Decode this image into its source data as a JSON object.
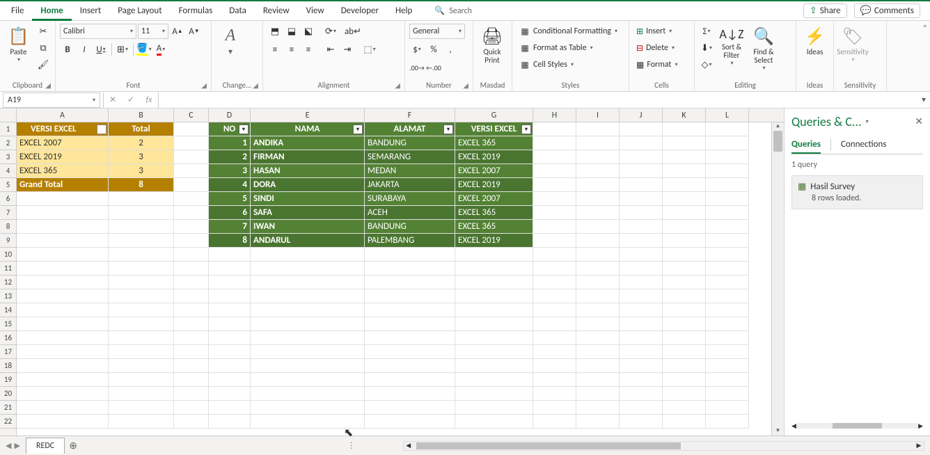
{
  "menu": {
    "tabs": [
      "File",
      "Home",
      "Insert",
      "Page Layout",
      "Formulas",
      "Data",
      "Review",
      "View",
      "Developer",
      "Help"
    ],
    "active": "Home",
    "search": "Search"
  },
  "title_buttons": {
    "share": "Share",
    "comments": "Comments"
  },
  "ribbon": {
    "clipboard": {
      "paste": "Paste",
      "label": "Clipboard"
    },
    "font": {
      "name": "Calibri",
      "size": "11",
      "label": "Font"
    },
    "change": {
      "label": "Change..."
    },
    "alignment": {
      "label": "Alignment"
    },
    "number": {
      "format": "General",
      "label": "Number"
    },
    "masdad": {
      "quickprint": "Quick\nPrint",
      "label": "Masdad"
    },
    "styles": {
      "cond": "Conditional Formatting",
      "table": "Format as Table",
      "cell": "Cell Styles",
      "label": "Styles"
    },
    "cells": {
      "insert": "Insert",
      "delete": "Delete",
      "format": "Format",
      "label": "Cells"
    },
    "editing": {
      "sort": "Sort &\nFilter",
      "find": "Find &\nSelect",
      "label": "Editing"
    },
    "ideas": {
      "ideas": "Ideas",
      "label": "Ideas"
    },
    "sensitivity": {
      "sens": "Sensitivity",
      "label": "Sensitivity"
    }
  },
  "formula_bar": {
    "name_box": "A19",
    "formula": ""
  },
  "columns": [
    {
      "l": "A",
      "w": 132
    },
    {
      "l": "B",
      "w": 94
    },
    {
      "l": "C",
      "w": 50
    },
    {
      "l": "D",
      "w": 60
    },
    {
      "l": "E",
      "w": 164
    },
    {
      "l": "F",
      "w": 130
    },
    {
      "l": "G",
      "w": 112
    },
    {
      "l": "H",
      "w": 62
    },
    {
      "l": "I",
      "w": 62
    },
    {
      "l": "J",
      "w": 62
    },
    {
      "l": "K",
      "w": 62
    },
    {
      "l": "L",
      "w": 62
    }
  ],
  "row_count": 22,
  "pivot": {
    "headers": [
      "VERSI EXCEL",
      "Total"
    ],
    "rows": [
      [
        "EXCEL 2007",
        "2"
      ],
      [
        "EXCEL 2019",
        "3"
      ],
      [
        "EXCEL 365",
        "3"
      ]
    ],
    "total": [
      "Grand Total",
      "8"
    ]
  },
  "green_table": {
    "headers": [
      "NO",
      "NAMA",
      "ALAMAT",
      "VERSI EXCEL"
    ],
    "rows": [
      [
        "1",
        "ANDIKA",
        "BANDUNG",
        "EXCEL 365"
      ],
      [
        "2",
        "FIRMAN",
        "SEMARANG",
        "EXCEL 2019"
      ],
      [
        "3",
        "HASAN",
        "MEDAN",
        "EXCEL 2007"
      ],
      [
        "4",
        "DORA",
        "JAKARTA",
        "EXCEL 2019"
      ],
      [
        "5",
        "SINDI",
        "SURABAYA",
        "EXCEL 2007"
      ],
      [
        "6",
        "SAFA",
        "ACEH",
        "EXCEL 365"
      ],
      [
        "7",
        "IWAN",
        "BANDUNG",
        "EXCEL 365"
      ],
      [
        "8",
        "ANDARUL",
        "PALEMBANG",
        "EXCEL 2019"
      ]
    ]
  },
  "queries": {
    "title": "Queries & C...",
    "tabs": [
      "Queries",
      "Connections"
    ],
    "count": "1 query",
    "item_name": "Hasil Survey",
    "item_status": "8 rows loaded."
  },
  "sheet": {
    "name": "REDC"
  }
}
